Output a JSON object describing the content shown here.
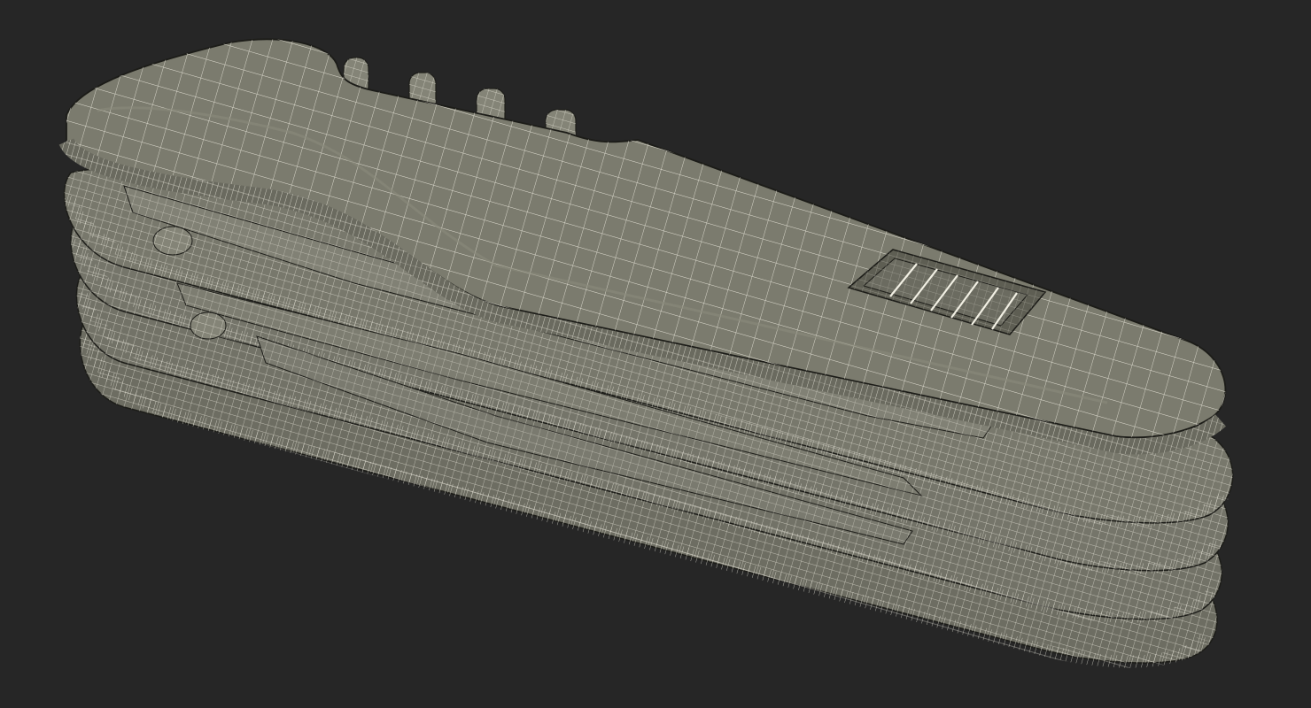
{
  "scene": {
    "subject": "multi-tool-knife-wireframe",
    "render_style": "wireframe",
    "colors": {
      "background": "#262626",
      "surface": "#7b7b6e",
      "surface_light": "#8a8a7c",
      "surface_dark": "#5e5e53",
      "wire": "#f2f0e4",
      "outline": "#1c1c18"
    },
    "layers": [
      "body-layer-5",
      "body-layer-4",
      "body-layer-3",
      "body-layer-2",
      "top-scale"
    ]
  }
}
